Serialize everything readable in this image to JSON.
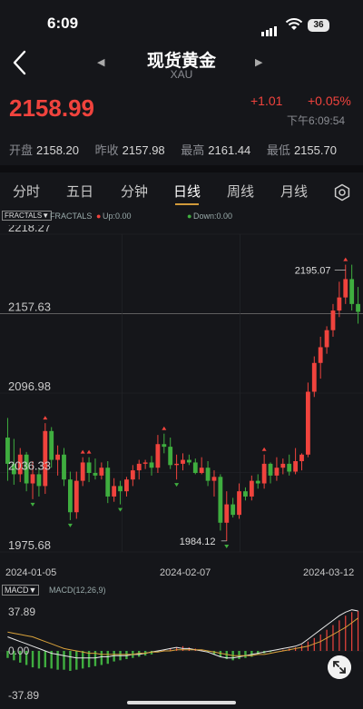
{
  "status_bar": {
    "time": "6:09",
    "battery": "36"
  },
  "header": {
    "title": "现货黄金",
    "subtitle": "XAU"
  },
  "quote": {
    "price": "2158.99",
    "change": "+1.01",
    "change_pct": "+0.05%",
    "time": "下午6:09:54",
    "open_label": "开盘",
    "open": "2158.20",
    "prev_label": "昨收",
    "prev": "2157.98",
    "high_label": "最高",
    "high": "2161.44",
    "low_label": "最低",
    "low": "2155.70"
  },
  "tabs": [
    {
      "label": "分时"
    },
    {
      "label": "五日"
    },
    {
      "label": "分钟"
    },
    {
      "label": "日线",
      "active": true
    },
    {
      "label": "周线"
    },
    {
      "label": "月线"
    }
  ],
  "indicator": {
    "button": "FRACTALS▼",
    "name": "FRACTALS",
    "up": "Up:0.00",
    "down": "Down:0.00"
  },
  "chart_data": {
    "type": "candlestick",
    "y_ticks": [
      "2218.27",
      "2157.63",
      "2096.98",
      "2036.33",
      "1975.68"
    ],
    "ylim": [
      1975.68,
      2218.27
    ],
    "x_ticks": [
      "2024-01-05",
      "2024-02-07",
      "2024-03-12"
    ],
    "annotations": {
      "max_label": "2195.07",
      "max_value": 2195.07,
      "min_label": "1984.12",
      "min_value": 1984.12
    },
    "reference_line": 2157.63,
    "candles": [
      [
        2063,
        2078,
        2030,
        2043
      ],
      [
        2043,
        2062,
        2027,
        2035
      ],
      [
        2035,
        2055,
        2029,
        2050
      ],
      [
        2050,
        2052,
        2022,
        2028
      ],
      [
        2028,
        2045,
        2016,
        2035
      ],
      [
        2035,
        2040,
        2018,
        2026
      ],
      [
        2026,
        2074,
        2020,
        2068
      ],
      [
        2068,
        2071,
        2040,
        2046
      ],
      [
        2046,
        2057,
        2034,
        2050
      ],
      [
        2050,
        2055,
        2026,
        2031
      ],
      [
        2031,
        2037,
        2000,
        2006
      ],
      [
        2006,
        2037,
        2001,
        2030
      ],
      [
        2030,
        2048,
        2026,
        2044
      ],
      [
        2044,
        2048,
        2029,
        2036
      ],
      [
        2036,
        2047,
        2031,
        2034
      ],
      [
        2034,
        2044,
        2031,
        2040
      ],
      [
        2040,
        2045,
        2013,
        2018
      ],
      [
        2018,
        2032,
        2014,
        2026
      ],
      [
        2026,
        2030,
        2012,
        2022
      ],
      [
        2022,
        2033,
        2018,
        2031
      ],
      [
        2031,
        2042,
        2026,
        2038
      ],
      [
        2038,
        2046,
        2031,
        2043
      ],
      [
        2043,
        2046,
        2039,
        2044
      ],
      [
        2044,
        2049,
        2034,
        2040
      ],
      [
        2040,
        2065,
        2036,
        2058
      ],
      [
        2058,
        2066,
        2051,
        2056
      ],
      [
        2056,
        2063,
        2039,
        2042
      ],
      [
        2042,
        2050,
        2031,
        2043
      ],
      [
        2043,
        2051,
        2038,
        2046
      ],
      [
        2046,
        2050,
        2042,
        2044
      ],
      [
        2044,
        2047,
        2035,
        2036
      ],
      [
        2036,
        2048,
        2035,
        2040
      ],
      [
        2040,
        2045,
        2026,
        2030
      ],
      [
        2030,
        2038,
        2018,
        2033
      ],
      [
        2033,
        2035,
        1992,
        1998
      ],
      [
        1998,
        2022,
        1984,
        2012
      ],
      [
        2012,
        2017,
        2002,
        2004
      ],
      [
        2004,
        2028,
        2001,
        2022
      ],
      [
        2022,
        2025,
        2015,
        2018
      ],
      [
        2018,
        2034,
        2015,
        2030
      ],
      [
        2030,
        2035,
        2024,
        2028
      ],
      [
        2028,
        2050,
        2024,
        2043
      ],
      [
        2043,
        2044,
        2028,
        2034
      ],
      [
        2034,
        2048,
        2030,
        2040
      ],
      [
        2040,
        2047,
        2035,
        2043
      ],
      [
        2043,
        2050,
        2034,
        2037
      ],
      [
        2037,
        2055,
        2035,
        2045
      ],
      [
        2045,
        2051,
        2038,
        2050
      ],
      [
        2050,
        2105,
        2048,
        2098
      ],
      [
        2098,
        2125,
        2094,
        2120
      ],
      [
        2120,
        2140,
        2108,
        2132
      ],
      [
        2132,
        2148,
        2127,
        2145
      ],
      [
        2145,
        2165,
        2140,
        2160
      ],
      [
        2160,
        2182,
        2155,
        2170
      ],
      [
        2170,
        2195,
        2165,
        2184
      ],
      [
        2184,
        2195,
        2160,
        2165
      ],
      [
        2165,
        2178,
        2150,
        2159
      ]
    ]
  },
  "macd": {
    "button": "MACD▼",
    "label": "MACD(12,26,9)",
    "y_ticks": [
      "37.89",
      "0.00",
      "-37.89"
    ],
    "ylim": [
      -37.89,
      37.89
    ],
    "hist": [
      -6,
      -8,
      -10,
      -12,
      -14,
      -15,
      -14,
      -15,
      -16,
      -16,
      -17,
      -16,
      -15,
      -14,
      -13,
      -12,
      -11,
      -9,
      -8,
      -7,
      -6,
      -5,
      -4,
      -3,
      -1,
      1,
      2,
      3,
      4,
      3,
      2,
      1,
      -1,
      -3,
      -5,
      -7,
      -8,
      -7,
      -6,
      -5,
      -3,
      -2,
      -1,
      0,
      1,
      2,
      3,
      5,
      8,
      11,
      14,
      18,
      22,
      26,
      30,
      33,
      34
    ],
    "dif": [
      12,
      10,
      8,
      6,
      4,
      2,
      0,
      -2,
      -3,
      -4,
      -5,
      -6,
      -6,
      -6,
      -6,
      -5,
      -5,
      -4,
      -4,
      -4,
      -3,
      -3,
      -2,
      -1,
      0,
      1,
      2,
      3,
      2,
      2,
      1,
      0,
      -1,
      -3,
      -5,
      -6,
      -6,
      -5,
      -4,
      -3,
      -2,
      -1,
      0,
      1,
      2,
      3,
      4,
      6,
      10,
      14,
      18,
      22,
      26,
      30,
      33,
      35,
      34
    ],
    "dea": [
      16,
      15,
      14,
      13,
      12,
      10,
      8,
      6,
      4,
      2,
      1,
      0,
      -1,
      -2,
      -2,
      -3,
      -3,
      -3,
      -3,
      -3,
      -3,
      -2,
      -2,
      -1,
      -1,
      0,
      0,
      1,
      1,
      1,
      1,
      1,
      0,
      -1,
      -2,
      -3,
      -4,
      -4,
      -4,
      -4,
      -3,
      -3,
      -2,
      -1,
      0,
      1,
      2,
      3,
      4,
      6,
      8,
      11,
      14,
      17,
      20,
      24,
      28
    ],
    "colors": {
      "up": "#f0433d",
      "down": "#3fae3f",
      "dif": "#e8e8e8",
      "dea": "#d9a23b"
    }
  },
  "colors": {
    "up": "#f0433d",
    "down": "#3fae3f",
    "accent": "#d19a3a",
    "background": "#15161a"
  }
}
